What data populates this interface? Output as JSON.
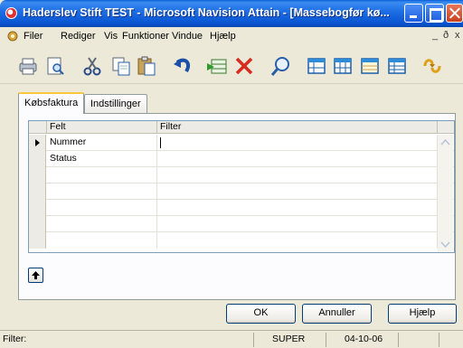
{
  "window": {
    "title": "Haderslev Stift TEST - Microsoft Navision Attain - [Massebogfør kø..."
  },
  "menu": {
    "items": [
      "Filer",
      "Rediger",
      "Vis",
      "Funktioner",
      "Vindue",
      "Hjælp"
    ],
    "mdi_controls": [
      "_",
      "ð",
      "x"
    ]
  },
  "toolbar": {
    "icons": [
      "printer-icon",
      "print-preview-icon",
      "cut-icon",
      "copy-icon",
      "paste-icon",
      "undo-icon",
      "insert-record-icon",
      "delete-icon",
      "find-icon",
      "form-icon",
      "list-icon",
      "card-icon",
      "table-icon",
      "navigate-icon"
    ]
  },
  "tabs": [
    {
      "label": "Købsfaktura",
      "active": true
    },
    {
      "label": "Indstillinger",
      "active": false
    }
  ],
  "grid": {
    "columns": [
      "Felt",
      "Filter"
    ],
    "rows": [
      {
        "felt": "Nummer",
        "filter": "",
        "selected": true
      },
      {
        "felt": "Status",
        "filter": "",
        "selected": false
      },
      {
        "felt": "",
        "filter": ""
      },
      {
        "felt": "",
        "filter": ""
      },
      {
        "felt": "",
        "filter": ""
      },
      {
        "felt": "",
        "filter": ""
      },
      {
        "felt": "",
        "filter": ""
      }
    ]
  },
  "buttons": {
    "ok": "OK",
    "cancel": "Annuller",
    "help": "Hjælp"
  },
  "statusbar": {
    "filter_label": "Filter:",
    "user": "SUPER",
    "date": "04-10-06"
  },
  "colors": {
    "titlebar": "#0a55d2",
    "face": "#ece9d8",
    "tab_highlight": "#ffc73c"
  }
}
